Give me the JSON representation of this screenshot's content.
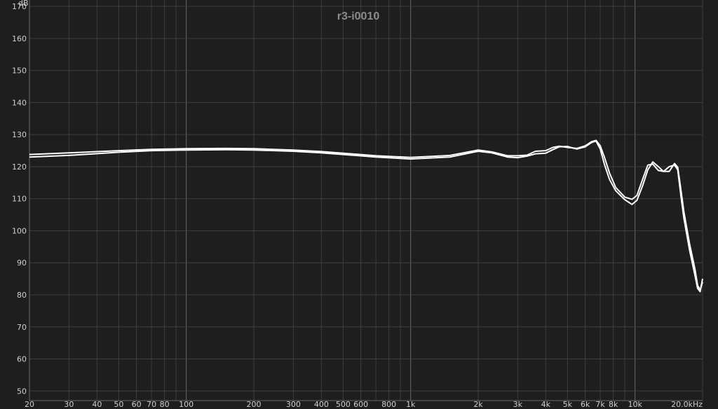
{
  "chart_data": {
    "type": "line",
    "title": "r3-i0010",
    "ylabel": "dB",
    "xlabel": "",
    "x_scale": "log",
    "xlim": [
      20,
      20000
    ],
    "ylim": [
      47,
      172
    ],
    "grid": true,
    "y_ticks": [
      50,
      60,
      70,
      80,
      90,
      100,
      110,
      120,
      130,
      140,
      150,
      160,
      170
    ],
    "x_ticks": [
      {
        "v": 20,
        "label": "20"
      },
      {
        "v": 30,
        "label": "30"
      },
      {
        "v": 40,
        "label": "40"
      },
      {
        "v": 50,
        "label": "50"
      },
      {
        "v": 60,
        "label": "60"
      },
      {
        "v": 70,
        "label": "70"
      },
      {
        "v": 80,
        "label": "80"
      },
      {
        "v": 100,
        "label": "100"
      },
      {
        "v": 200,
        "label": "200"
      },
      {
        "v": 300,
        "label": "300"
      },
      {
        "v": 400,
        "label": "400"
      },
      {
        "v": 500,
        "label": "500"
      },
      {
        "v": 600,
        "label": "600"
      },
      {
        "v": 800,
        "label": "800"
      },
      {
        "v": 1000,
        "label": "1k"
      },
      {
        "v": 2000,
        "label": "2k"
      },
      {
        "v": 3000,
        "label": "3k"
      },
      {
        "v": 4000,
        "label": "4k"
      },
      {
        "v": 5000,
        "label": "5k"
      },
      {
        "v": 6000,
        "label": "6k"
      },
      {
        "v": 7000,
        "label": "7k"
      },
      {
        "v": 8000,
        "label": "8k"
      },
      {
        "v": 10000,
        "label": "10k"
      },
      {
        "v": 20000,
        "label": "20.0kHz"
      }
    ],
    "series": [
      {
        "x": [
          20,
          30,
          50,
          70,
          100,
          150,
          200,
          300,
          400,
          500,
          700,
          1000,
          1500,
          2000,
          2300,
          2700,
          3000,
          3300,
          3600,
          4000,
          4300,
          4600,
          5000,
          5500,
          6000,
          6400,
          6700,
          7000,
          7300,
          7700,
          8200,
          9000,
          9700,
          10200,
          10800,
          11400,
          12000,
          12700,
          13400,
          14200,
          15000,
          15500,
          16000,
          16500,
          17500,
          18500,
          19000,
          19500,
          20000
        ],
        "y": [
          123.0,
          123.5,
          124.5,
          125.0,
          125.2,
          125.3,
          125.2,
          124.8,
          124.3,
          123.8,
          123.0,
          122.4,
          123.0,
          124.8,
          124.3,
          123.0,
          122.8,
          123.3,
          124.0,
          124.2,
          125.3,
          126.2,
          126.3,
          125.5,
          126.2,
          127.5,
          128.0,
          125.5,
          120.8,
          116.0,
          112.5,
          109.7,
          108.2,
          109.5,
          114.0,
          119.0,
          121.5,
          120.0,
          118.5,
          118.5,
          121.0,
          119.8,
          113.0,
          106.0,
          96.0,
          88.0,
          83.0,
          81.5,
          84.0
        ]
      },
      {
        "x": [
          20,
          30,
          50,
          70,
          100,
          150,
          200,
          300,
          400,
          500,
          700,
          1000,
          1500,
          2000,
          2300,
          2700,
          3000,
          3300,
          3600,
          4000,
          4300,
          4600,
          5000,
          5500,
          6000,
          6400,
          6700,
          7000,
          7300,
          7700,
          8200,
          9000,
          9700,
          10200,
          10800,
          11400,
          12000,
          12700,
          13400,
          14200,
          15000,
          15500,
          16000,
          16500,
          17500,
          18500,
          19000,
          19500,
          20000
        ],
        "y": [
          123.8,
          124.3,
          125.0,
          125.4,
          125.6,
          125.7,
          125.6,
          125.2,
          124.7,
          124.2,
          123.4,
          122.9,
          123.5,
          125.2,
          124.6,
          123.4,
          123.4,
          123.6,
          124.8,
          125.0,
          126.0,
          126.4,
          126.0,
          125.7,
          126.5,
          127.8,
          128.2,
          126.5,
          123.0,
          118.0,
          113.5,
          110.5,
          109.8,
          111.0,
          116.0,
          120.5,
          120.8,
          118.8,
          118.5,
          120.0,
          120.5,
          119.0,
          111.0,
          104.0,
          94.0,
          86.0,
          82.0,
          81.0,
          85.0
        ]
      }
    ],
    "colors": {
      "background": "#1e1e1e",
      "grid": "#3e3e3e",
      "grid_major": "#6a6a6a",
      "line": "#ffffff",
      "title": "#8c8c8c",
      "tick": "#cfcfcf"
    }
  }
}
